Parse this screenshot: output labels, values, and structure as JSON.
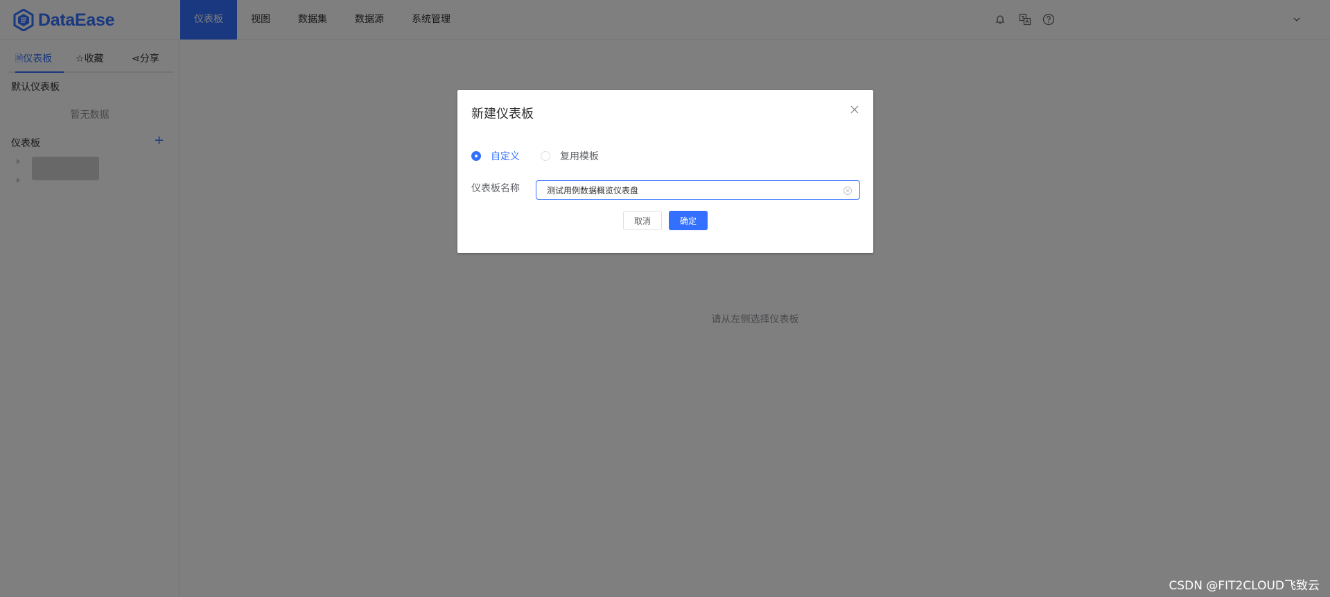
{
  "app": {
    "logo_text": "DataEase"
  },
  "nav": {
    "items": [
      {
        "label": "仪表板",
        "active": true
      },
      {
        "label": "视图"
      },
      {
        "label": "数据集"
      },
      {
        "label": "数据源"
      },
      {
        "label": "系统管理"
      }
    ]
  },
  "header_icons": [
    "bell-icon",
    "translate-icon",
    "help-icon",
    "chevron-down-icon"
  ],
  "sidebar": {
    "tabs": [
      {
        "label": "仪表板",
        "icon": "document-icon",
        "active": true
      },
      {
        "label": "收藏",
        "icon": "star-icon"
      },
      {
        "label": "分享",
        "icon": "share-icon"
      }
    ],
    "default_section_title": "默认仪表板",
    "default_empty_text": "暂无数据",
    "dashboards_section_title": "仪表板"
  },
  "main": {
    "empty_hint": "请从左侧选择仪表板"
  },
  "dialog": {
    "title": "新建仪表板",
    "radio_custom": "自定义",
    "radio_template": "复用模板",
    "name_label": "仪表板名称",
    "name_value": "测试用例数据概览仪表盘",
    "cancel_label": "取消",
    "confirm_label": "确定"
  },
  "watermark": "CSDN @FIT2CLOUD飞致云",
  "colors": {
    "accent": "#3370ff",
    "mask": "rgba(0,0,0,0.5)"
  }
}
